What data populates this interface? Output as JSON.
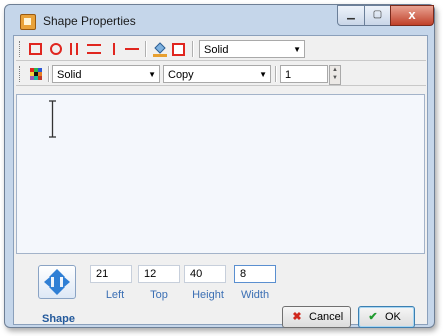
{
  "window": {
    "title": "Shape Properties",
    "close_glyph": "x"
  },
  "toolbar1": {
    "tools": [
      "rectangle-icon",
      "ellipse-icon",
      "vertical-lines-icon",
      "horizontal-lines-icon",
      "vertical-line-icon",
      "horizontal-line-icon",
      "fill-bucket-icon",
      "fill-color-icon"
    ],
    "line_style": "Solid"
  },
  "toolbar2": {
    "fill_style": "Solid",
    "copy_mode": "Copy",
    "line_width": "1"
  },
  "fields": {
    "left": {
      "value": "21",
      "label": "Left"
    },
    "top": {
      "value": "12",
      "label": "Top"
    },
    "height": {
      "value": "40",
      "label": "Height"
    },
    "width": {
      "value": "8",
      "label": "Width"
    }
  },
  "shape_label": "Shape",
  "buttons": {
    "cancel": "Cancel",
    "ok": "OK"
  },
  "colors": {
    "tool_red": "#e0261f",
    "accent_blue": "#3b6fb4",
    "frame": "#c5d6ea"
  }
}
